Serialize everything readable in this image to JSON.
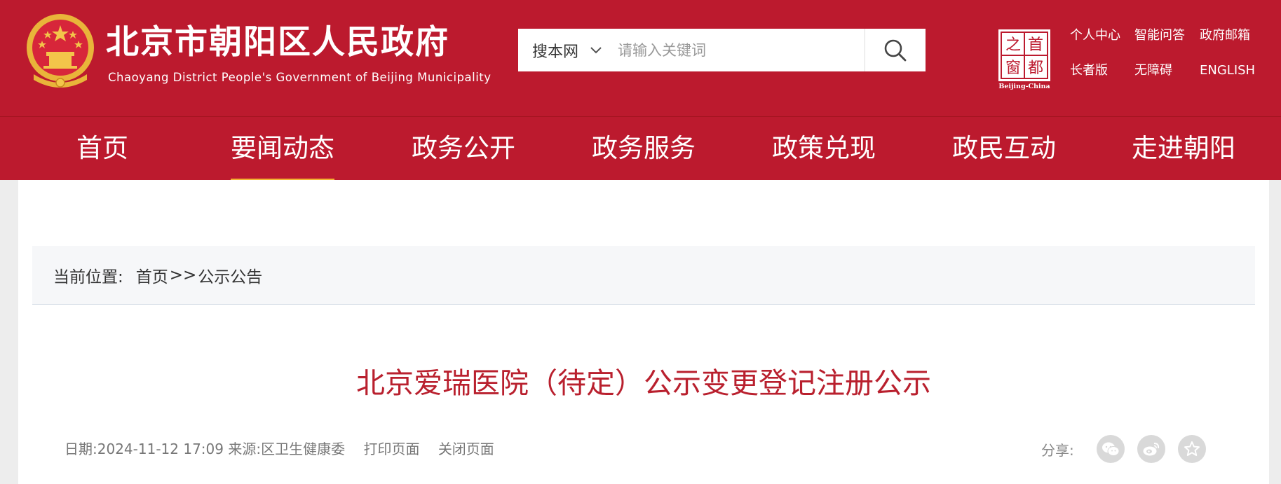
{
  "header": {
    "title_cn": "北京市朝阳区人民政府",
    "title_en": "Chaoyang District People's Government of Beijing Municipality",
    "logo_text": [
      "首",
      "都",
      "之",
      "窗"
    ],
    "logo_caption": "Beijing-China",
    "search": {
      "scope": "搜本网",
      "placeholder": "请输入关键词"
    },
    "links_row1": [
      "个人中心",
      "智能问答",
      "政府邮箱"
    ],
    "links_row2": [
      "长者版",
      "无障碍",
      "ENGLISH"
    ]
  },
  "nav": {
    "items": [
      "首页",
      "要闻动态",
      "政务公开",
      "政务服务",
      "政策兑现",
      "政民互动",
      "走进朝阳"
    ],
    "active_index": 1
  },
  "breadcrumb": {
    "label": "当前位置:",
    "home": "首页",
    "separator": ">>",
    "current": "公示公告"
  },
  "article": {
    "title": "北京爱瑞医院（待定）公示变更登记注册公示",
    "date_label": "日期:",
    "date": "2024-11-12 17:09",
    "source_label": "来源:",
    "source": "区卫生健康委",
    "print": "打印页面",
    "close": "关闭页面",
    "share_label": "分享:"
  },
  "colors": {
    "brand_red": "#bc1a2e",
    "title_red": "#b9202e",
    "nav_active_underline": "#f4b233"
  }
}
